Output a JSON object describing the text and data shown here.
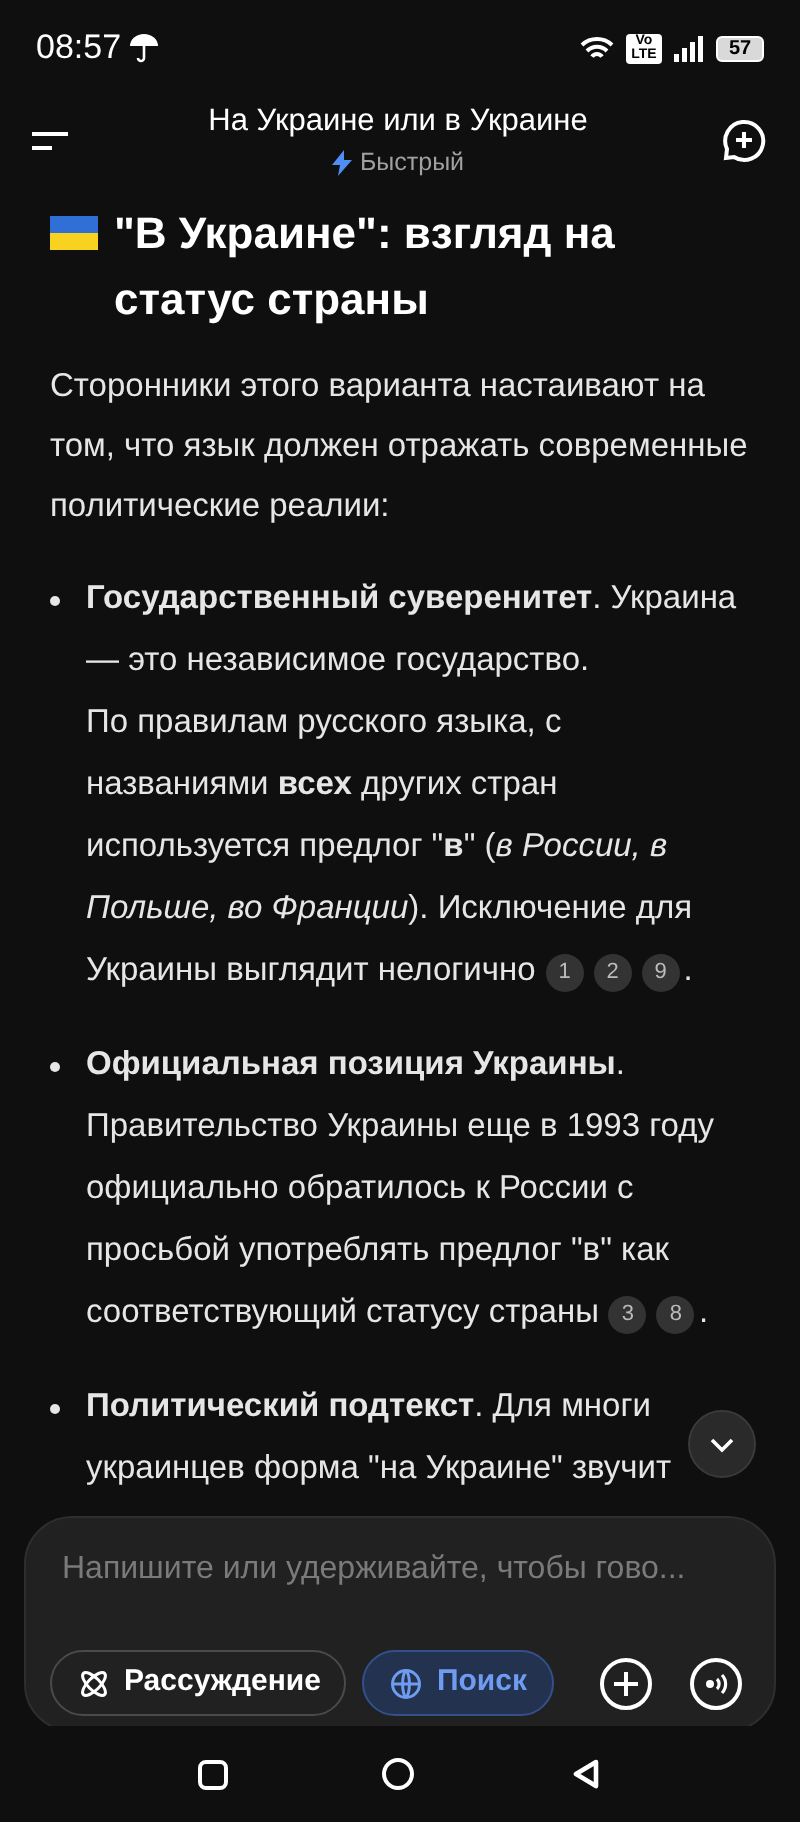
{
  "status_bar": {
    "time": "08:57",
    "battery": "57",
    "volte": "Vo LTE"
  },
  "header": {
    "title": "На Украине или в Украине",
    "mode": "Быстрый"
  },
  "heading": "\"В Украине\": взгляд на статус страны",
  "intro": "Сторонники этого варианта настаивают на том, что язык должен отражать современные политические реалии:",
  "bullets": [
    {
      "parts": [
        "**Государственный суверенитет**. Украина — это независимое государство.",
        "По правилам русского языка, с названиями **всех** других стран используется предлог \"**в**\" (*в России, в Польше, во Франции*). Исключение для Украины выглядит нелогично"
      ],
      "citations": [
        "1",
        "2",
        "9"
      ],
      "end": "."
    },
    {
      "parts": [
        "**Официальная позиция Украины**. Правительство Украины еще в 1993 году официально обратилось к России с просьбой употреблять предлог \"в\" как соответствующий статусу страны"
      ],
      "citations": [
        "3",
        "8"
      ],
      "end": "."
    },
    {
      "parts": [
        "**Политический подтекст**. Для многи украинцев форма \"на Украине\" звучит"
      ]
    }
  ],
  "composer": {
    "placeholder": "Напишите или удерживайте, чтобы гово...",
    "chips": [
      {
        "label": "Рассуждение",
        "kind": "reasoning",
        "selected": false
      },
      {
        "label": "Поиск",
        "kind": "search",
        "selected": true
      }
    ]
  }
}
